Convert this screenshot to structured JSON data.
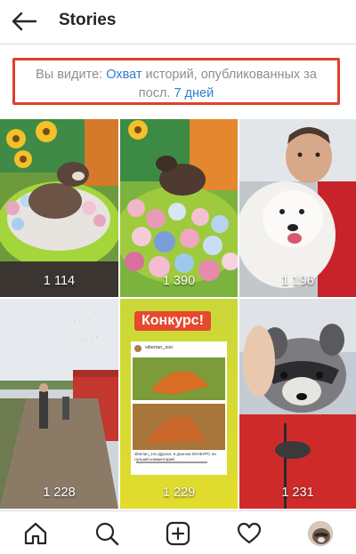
{
  "header": {
    "title": "Stories"
  },
  "info": {
    "prefix": "Вы видите: ",
    "metric_link": "Охват",
    "middle": " историй, опубликованных за посл. ",
    "period_link": "7 дней"
  },
  "tiles": [
    {
      "count": "1 114"
    },
    {
      "count": "1 390"
    },
    {
      "count": "1 196"
    },
    {
      "count": "1 228"
    },
    {
      "count": "1 229"
    },
    {
      "count": "1 231"
    }
  ],
  "contest": {
    "banner": "Конкурс!",
    "username": "siberian_zoo",
    "caption": "siberian_zoo Друзья, в данном КОНКУРС на лучший комментарий"
  },
  "colors": {
    "accent_link": "#2f7fc6",
    "highlight_border": "#e0402a"
  },
  "nav": {
    "home_icon": "home-icon",
    "search_icon": "search-icon",
    "add_icon": "add-post-icon",
    "activity_icon": "heart-icon",
    "profile_icon": "profile-avatar"
  }
}
